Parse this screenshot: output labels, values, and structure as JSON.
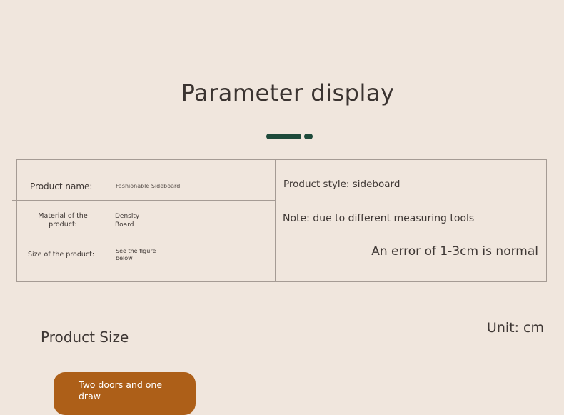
{
  "title": "Parameter display",
  "params": {
    "product_name_label": "Product name:",
    "product_name_value": "Fashionable Sideboard",
    "material_label": "Material of the product:",
    "material_value": "Density Board",
    "size_label": "Size of the product:",
    "size_value": "See the figure below",
    "style_line": "Product style: sideboard",
    "note_line": "Note: due to different measuring tools",
    "error_line": "An error of 1-3cm is normal"
  },
  "unit": "Unit: cm",
  "size_heading": "Product Size",
  "tag": "Two doors and one draw",
  "colors": {
    "background": "#f0e6dd",
    "accent_green": "#1e4a3a",
    "accent_orange": "#ad5f18"
  }
}
